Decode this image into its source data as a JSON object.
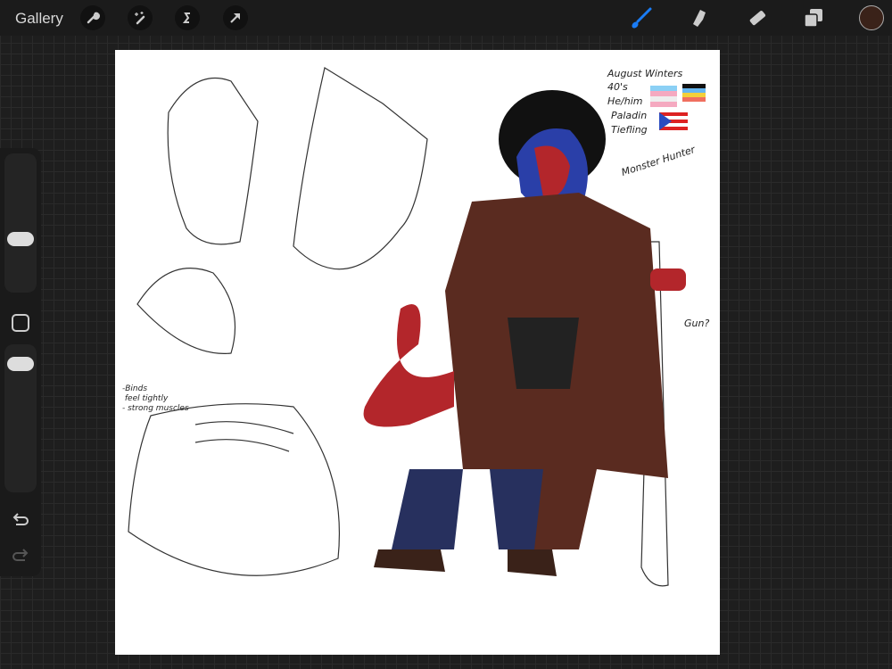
{
  "topbar": {
    "gallery_label": "Gallery",
    "left_tools": [
      "wrench-icon",
      "magic-wand-icon",
      "selection-icon",
      "move-arrow-icon"
    ],
    "right_tools": [
      "brush-icon",
      "smudge-icon",
      "eraser-icon",
      "layers-icon"
    ],
    "active_tool": "brush",
    "accent": "#1a7cf5",
    "current_color": "#3a2219"
  },
  "sidebar": {
    "brush_size": 0.6,
    "opacity": 0.85,
    "items": [
      "brush-size-slider",
      "modify-button",
      "opacity-slider",
      "undo-button",
      "redo-button"
    ]
  },
  "canvas": {
    "notes": {
      "name": "August Winters",
      "age": "40's",
      "pronouns": "He/him",
      "class": "Paladin",
      "race": "Tiefling",
      "role": "Monster Hunter",
      "sketch_note": "-Binds\n feel tightly\n- strong muscles",
      "gun_note": "Gun?"
    }
  }
}
